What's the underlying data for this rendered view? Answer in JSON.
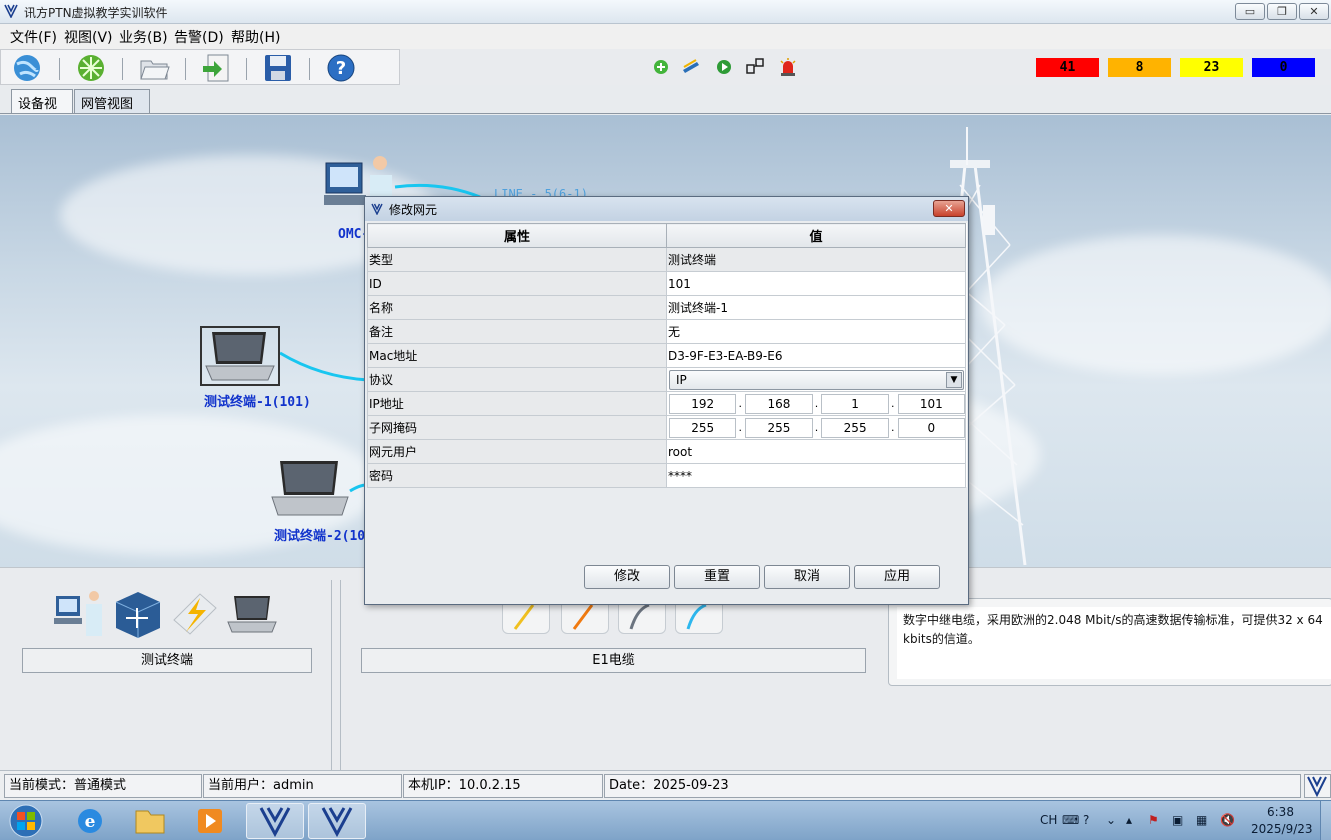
{
  "window": {
    "title": "讯方PTN虚拟教学实训软件"
  },
  "menu": [
    {
      "label": "文件(F)"
    },
    {
      "label": "视图(V)"
    },
    {
      "label": "业务(B)"
    },
    {
      "label": "告警(D)"
    },
    {
      "label": "帮助(H)"
    }
  ],
  "toolbar": {
    "buttons": [
      "globe-icon",
      "network-icon",
      "folder-open-icon",
      "export-icon",
      "save-icon",
      "help-icon"
    ],
    "status_icons": [
      "add-icon",
      "equipment-icon",
      "play-icon",
      "topology-icon",
      "alarm-siren-icon"
    ]
  },
  "alarms": [
    {
      "count": "41",
      "color": "#ff0000"
    },
    {
      "count": "8",
      "color": "#ffb300"
    },
    {
      "count": "23",
      "color": "#ffff00"
    },
    {
      "count": "0",
      "color": "#0000ff"
    }
  ],
  "tabs": [
    {
      "label": "设备视图"
    },
    {
      "label": "网管视图"
    }
  ],
  "canvas": {
    "nodes": [
      {
        "label": "OMC-"
      },
      {
        "label": "测试终端-1(101)"
      },
      {
        "label": "测试终端-2(10"
      }
    ],
    "link_label": "LINE - 5(6-1)"
  },
  "palette": {
    "left_label": "测试终端",
    "middle_label": "E1电缆",
    "description": "数字中继电缆，采用欧洲的2.048 Mbit/s的高速数据传输标准，可提供32 x 64 kbits的信道。"
  },
  "dialog": {
    "title": "修改网元",
    "headers": {
      "key": "属性",
      "value": "值"
    },
    "rows": {
      "type": {
        "key": "类型",
        "value": "测试终端"
      },
      "id": {
        "key": "ID",
        "value": "101"
      },
      "name": {
        "key": "名称",
        "value": "测试终端-1"
      },
      "note": {
        "key": "备注",
        "value": "无"
      },
      "mac": {
        "key": "Mac地址",
        "value": "D3-9F-E3-EA-B9-E6"
      },
      "protocol": {
        "key": "协议",
        "value": "IP"
      },
      "ip": {
        "key": "IP地址",
        "octets": [
          "192",
          "168",
          "1",
          "101"
        ]
      },
      "mask": {
        "key": "子网掩码",
        "octets": [
          "255",
          "255",
          "255",
          "0"
        ]
      },
      "user": {
        "key": "网元用户",
        "value": "root"
      },
      "password": {
        "key": "密码",
        "value": "****"
      }
    },
    "buttons": {
      "modify": "修改",
      "reset": "重置",
      "cancel": "取消",
      "apply": "应用"
    }
  },
  "status": {
    "mode": "当前模式：普通模式",
    "user": "当前用户：admin",
    "ip": "本机IP：10.0.2.15",
    "date": "Date：2025-09-23"
  },
  "taskbar": {
    "lang": "CH",
    "time": "6:38",
    "date": "2025/9/23"
  }
}
